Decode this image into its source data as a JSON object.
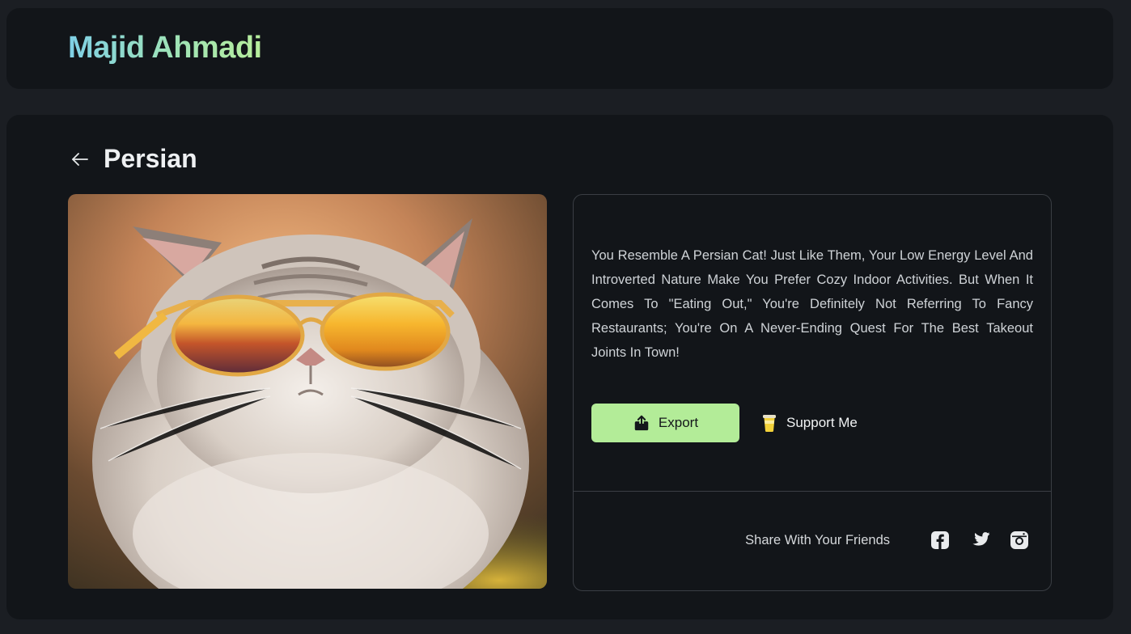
{
  "header": {
    "brand": "Majid Ahmadi"
  },
  "page": {
    "title": "Persian"
  },
  "result": {
    "description": "You Resemble A Persian Cat! Just Like Them, Your Low Energy Level And Introverted Nature Make You Prefer Cozy Indoor Activities. But When It Comes To \"Eating Out,\" You're Definitely Not Referring To Fancy Restaurants; You're On A Never-Ending Quest For The Best Takeout Joints In Town!",
    "export_label": "Export",
    "support_label": "Support Me",
    "share_label": "Share With Your Friends"
  },
  "colors": {
    "accent": "#b3ec98",
    "background": "#1b1e23",
    "panel": "#121519"
  },
  "icons": [
    "back-arrow-icon",
    "upload-icon",
    "coffee-cup-icon",
    "facebook-icon",
    "twitter-icon",
    "instagram-icon"
  ]
}
